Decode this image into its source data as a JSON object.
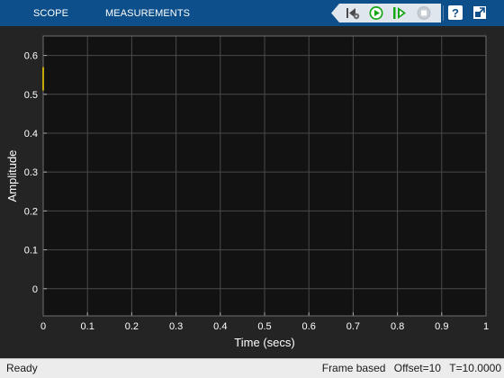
{
  "toolbar": {
    "tabs": [
      {
        "label": "SCOPE"
      },
      {
        "label": "MEASUREMENTS"
      }
    ],
    "icons": {
      "step_back": "step-back-icon",
      "run": "run-icon",
      "step_forward": "step-forward-icon",
      "stop": "stop-icon",
      "help": "help-icon",
      "undock": "undock-icon"
    }
  },
  "colors": {
    "toolbar_bg": "#0d4f8a",
    "plot_bg": "#121212",
    "grid": "#4a4a4a",
    "signal": "#ffd700",
    "run_green": "#14a614"
  },
  "chart_data": {
    "type": "line",
    "xlabel": "Time (secs)",
    "ylabel": "Amplitude",
    "xlim": [
      0,
      1
    ],
    "ylim": [
      -0.07,
      0.65
    ],
    "xticks": [
      "0",
      "0.1",
      "0.2",
      "0.3",
      "0.4",
      "0.5",
      "0.6",
      "0.7",
      "0.8",
      "0.9",
      "1"
    ],
    "xtick_values": [
      0,
      0.1,
      0.2,
      0.3,
      0.4,
      0.5,
      0.6,
      0.7,
      0.8,
      0.9,
      1.0
    ],
    "yticks": [
      "0",
      "0.1",
      "0.2",
      "0.3",
      "0.4",
      "0.5",
      "0.6"
    ],
    "ytick_values": [
      0,
      0.1,
      0.2,
      0.3,
      0.4,
      0.5,
      0.6
    ],
    "grid": true,
    "series": [
      {
        "x": [
          0,
          0
        ],
        "y": [
          0.57,
          0.51
        ]
      }
    ]
  },
  "statusbar": {
    "left": "Ready",
    "mode": "Frame based",
    "offset": "Offset=10",
    "time": "T=10.0000"
  }
}
